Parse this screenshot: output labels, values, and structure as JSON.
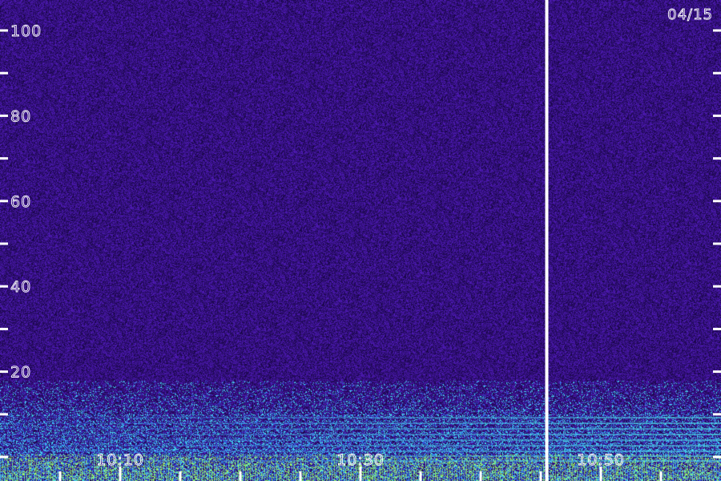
{
  "date_label": "04/15",
  "colors": {
    "background": "#2a0a5e",
    "noise_dark": "#12043a",
    "noise_violet": "#5a1fd0",
    "band_blue": "#2c6cf0",
    "band_cyan": "#46e8f0",
    "band_green": "#b8ff40",
    "marker": "#ffffff"
  },
  "chart_data": {
    "type": "heatmap",
    "title": "",
    "xlabel": "",
    "ylabel": "",
    "y_ticks": [
      {
        "value": 100,
        "label": "100"
      },
      {
        "value": 80,
        "label": "80"
      },
      {
        "value": 60,
        "label": "60"
      },
      {
        "value": 40,
        "label": "40"
      },
      {
        "value": 20,
        "label": "20"
      }
    ],
    "y_minor_ticks": [
      0,
      10,
      30,
      50,
      70,
      90
    ],
    "ylim": [
      0,
      102
    ],
    "x_ticks": [
      {
        "value": 10,
        "label": "10:10"
      },
      {
        "value": 30,
        "label": "10:30"
      },
      {
        "value": 50,
        "label": "10:50"
      }
    ],
    "x_minor_ticks": [
      5,
      15,
      20,
      25,
      35,
      40,
      45,
      55
    ],
    "xlim": [
      4.9,
      59.5
    ],
    "marker_time": 45.5,
    "intensity_bands": [
      {
        "y_from": 0,
        "y_to": 3,
        "level": "high"
      },
      {
        "y_from": 3,
        "y_to": 10,
        "level": "medium"
      },
      {
        "y_from": 10,
        "y_to": 18,
        "level": "low"
      },
      {
        "y_from": 18,
        "y_to": 102,
        "level": "background"
      }
    ],
    "grid": false
  }
}
